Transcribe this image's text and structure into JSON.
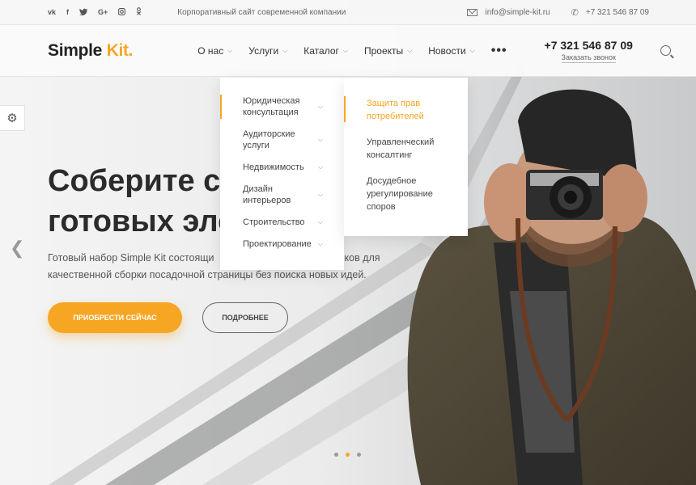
{
  "topbar": {
    "social": [
      "vk",
      "f",
      "tw",
      "G+",
      "ig",
      "ok"
    ],
    "tagline": "Корпоративный сайт современной компании",
    "email": "info@simple-kit.ru",
    "phone": "+7 321 546 87 09"
  },
  "header": {
    "logo_main": "Simple ",
    "logo_accent": "Kit.",
    "nav": [
      {
        "label": "О нас"
      },
      {
        "label": "Услуги"
      },
      {
        "label": "Каталог"
      },
      {
        "label": "Проекты"
      },
      {
        "label": "Новости"
      }
    ],
    "more": "•••",
    "phone": "+7 321 546 87 09",
    "callback": "Заказать звонок"
  },
  "hero": {
    "title_line1": "Соберите с",
    "title_line2": "готовых эле",
    "description": "Готовый набор Simple Kit состоящий из ... блоков для качественной сборки посадочной страницы без поиска новых идей.",
    "desc_line1_a": "Готовый набор Simple Kit состоящи",
    "desc_line1_b": "блоков для",
    "desc_line2": "качественной сборки посадочной страницы без поиска новых идей.",
    "btn_primary": "ПРИОБРЕСТИ СЕЙЧАС",
    "btn_secondary": "ПОДРОБНЕЕ",
    "slides": 3,
    "active_slide": 2
  },
  "dropdown": {
    "level1": [
      {
        "label": "Юридическая консультация",
        "active": true
      },
      {
        "label": "Аудиторские услуги"
      },
      {
        "label": "Недвижимость"
      },
      {
        "label": "Дизайн интерьеров"
      },
      {
        "label": "Строительство"
      },
      {
        "label": "Проектирование"
      }
    ],
    "level2": [
      {
        "label": "Защита прав потребителей",
        "active": true
      },
      {
        "label": "Управленческий консалтинг"
      },
      {
        "label": "Досудебное урегулирование споров"
      }
    ]
  },
  "colors": {
    "accent": "#f6a623",
    "text": "#2b2b2b"
  }
}
